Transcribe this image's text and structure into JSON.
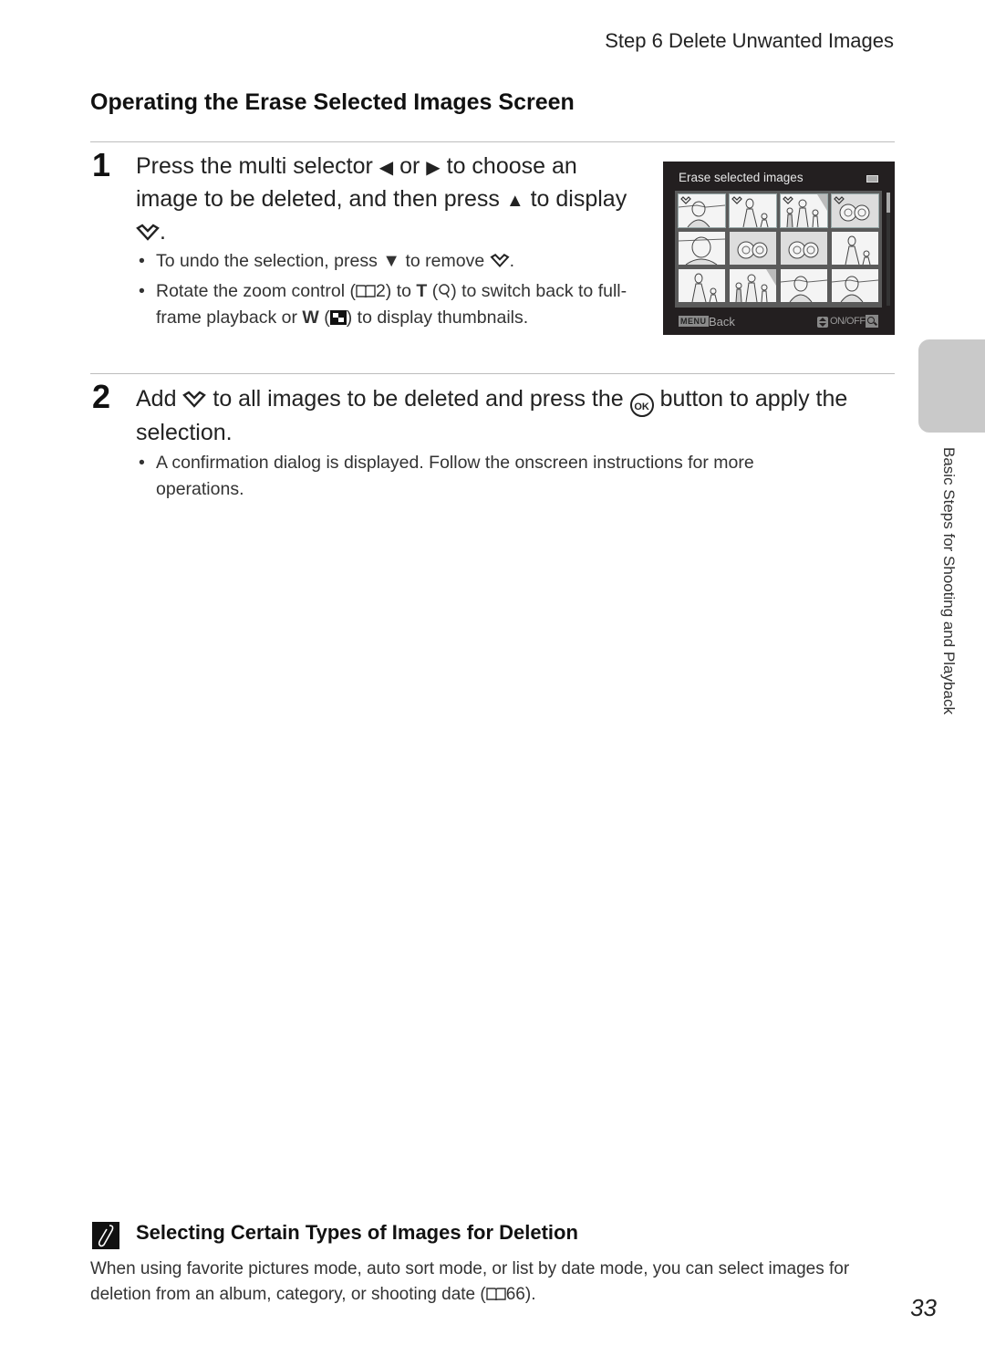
{
  "running_head": "Step 6 Delete Unwanted Images",
  "section_title": "Operating the Erase Selected Images Screen",
  "steps": [
    {
      "number": "1",
      "text_parts": [
        "Press the multi selector ",
        "◀",
        " or ",
        "▶",
        " to choose an image to be deleted, and then press ",
        "▲",
        " to display ",
        "."
      ],
      "bullets": [
        {
          "parts": [
            "To undo the selection, press ",
            "▼",
            " to remove ",
            "."
          ]
        },
        {
          "parts": [
            "Rotate the zoom control (",
            "2) to ",
            "T",
            " (",
            ") to switch back to full-frame playback or ",
            "W",
            " (",
            ") to display thumbnails."
          ]
        }
      ]
    },
    {
      "number": "2",
      "text_parts": [
        "Add ",
        " to all images to be deleted and press the ",
        "OK",
        " button to apply the selection."
      ],
      "bullets": [
        {
          "text": "A confirmation dialog is displayed. Follow the onscreen instructions for more operations."
        }
      ]
    }
  ],
  "camera_screen": {
    "title": "Erase selected images",
    "back_key": "MENU",
    "back_label": "Back",
    "toggle_label": "ON/OFF",
    "thumbnails": [
      {
        "subject": "woman-portrait-outdoor",
        "selected": true
      },
      {
        "subject": "woman-with-child",
        "selected": true
      },
      {
        "subject": "family-walking",
        "selected": true
      },
      {
        "subject": "flowers",
        "selected": true
      },
      {
        "subject": "woman-closeup",
        "selected": false
      },
      {
        "subject": "flowers",
        "selected": false
      },
      {
        "subject": "flowers",
        "selected": false
      },
      {
        "subject": "woman-with-child",
        "selected": false
      },
      {
        "subject": "woman-with-child",
        "selected": false
      },
      {
        "subject": "family-walking",
        "selected": false
      },
      {
        "subject": "woman-portrait-outdoor",
        "selected": false
      },
      {
        "subject": "woman-portrait-outdoor",
        "selected": false
      }
    ]
  },
  "side_tab_label": "Basic Steps for Shooting and Playback",
  "note": {
    "title": "Selecting Certain Types of Images for Deletion",
    "body_parts": [
      "When using favorite pictures mode, auto sort mode, or list by date mode, you can select images for deletion from an album, category, or shooting date (",
      "66)."
    ]
  },
  "page_number": "33",
  "icons": {
    "book": "📖",
    "left": "◀",
    "right": "▶",
    "up": "▲",
    "down": "▼"
  }
}
